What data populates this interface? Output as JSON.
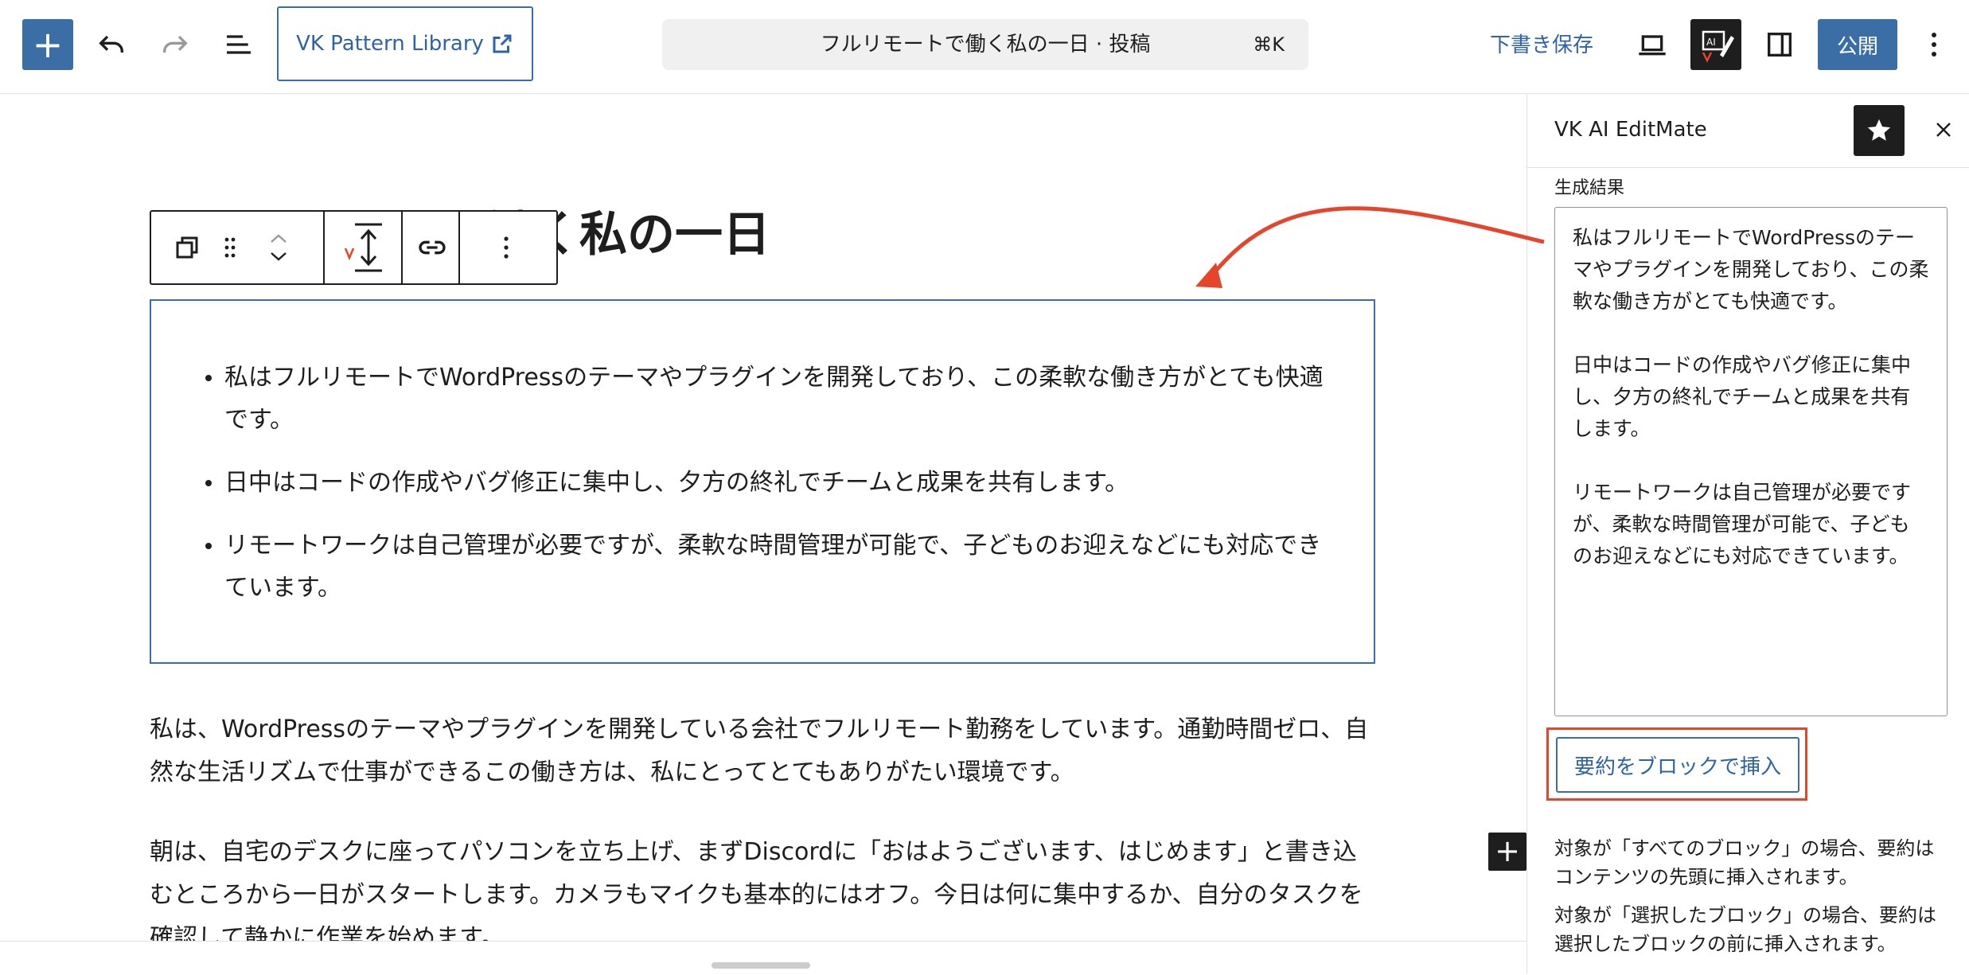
{
  "header": {
    "add_label": "+",
    "vk_library_label": "VK Pattern Library",
    "command_title": "フルリモートで働く私の一日 · 投稿",
    "command_shortcut": "⌘K",
    "save_draft_label": "下書き保存",
    "publish_label": "公開"
  },
  "editor": {
    "post_title": "フルリモートで働く私の一日",
    "list_items": [
      "私はフルリモートでWordPressのテーマやプラグインを開発しており、この柔軟な働き方がとても快適です。",
      "日中はコードの作成やバグ修正に集中し、夕方の終礼でチームと成果を共有します。",
      "リモートワークは自己管理が必要ですが、柔軟な時間管理が可能で、子どものお迎えなどにも対応できています。"
    ],
    "paragraph_1": "私は、WordPressのテーマやプラグインを開発している会社でフルリモート勤務をしています。通勤時間ゼロ、自然な生活リズムで仕事ができるこの働き方は、私にとってとてもありがたい環境です。",
    "paragraph_2": "朝は、自宅のデスクに座ってパソコンを立ち上げ、まずDiscordに「おはようございます、はじめます」と書き込むところから一日がスタートします。カメラもマイクも基本的にはオフ。今日は何に集中するか、自分のタスクを確認して静かに作業を始めます。"
  },
  "sidebar": {
    "title": "VK AI EditMate",
    "result_label": "生成結果",
    "result_text": "私はフルリモートでWordPressのテーマやプラグインを開発しており、この柔軟な働き方がとても快適です。\n\n日中はコードの作成やバグ修正に集中し、夕方の終礼でチームと成果を共有します。\n\nリモートワークは自己管理が必要ですが、柔軟な時間管理が可能で、子どものお迎えなどにも対応できています。",
    "insert_button_label": "要約をブロックで挿入",
    "note_1": "対象が「すべてのブロック」の場合、要約はコンテンツの先頭に挿入されます。",
    "note_2": "対象が「選択したブロック」の場合、要約は選択したブロックの前に挿入されます。"
  },
  "colors": {
    "accent": "#3a6ea5",
    "annotation": "#e5462b",
    "dark": "#1e1e1e"
  }
}
